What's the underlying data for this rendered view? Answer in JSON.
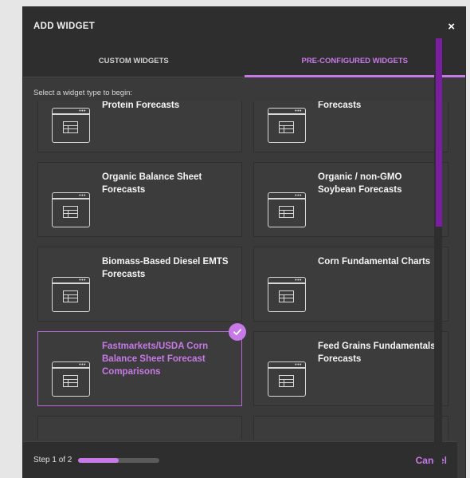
{
  "modal": {
    "title": "ADD WIDGET",
    "close_label": "×"
  },
  "tabs": [
    {
      "label": "CUSTOM WIDGETS",
      "active": false
    },
    {
      "label": "PRE-CONFIGURED WIDGETS",
      "active": true
    }
  ],
  "instruction": "Select a widget type to begin:",
  "widgets": [
    {
      "title": "Organic / non-GMO Animal Protein Forecasts",
      "selected": false,
      "icon": "table-window-icon"
    },
    {
      "title": "Organic / non-GMO Corn Forecasts",
      "selected": false,
      "icon": "table-window-icon"
    },
    {
      "title": "Organic Balance Sheet Forecasts",
      "selected": false,
      "icon": "table-window-icon"
    },
    {
      "title": "Organic / non-GMO Soybean Forecasts",
      "selected": false,
      "icon": "table-window-icon"
    },
    {
      "title": "Biomass-Based Diesel EMTS Forecasts",
      "selected": false,
      "icon": "table-window-icon"
    },
    {
      "title": "Corn Fundamental Charts",
      "selected": false,
      "icon": "table-window-icon"
    },
    {
      "title": "Fastmarkets/USDA Corn Balance Sheet Forecast Comparisons",
      "selected": true,
      "icon": "table-window-icon"
    },
    {
      "title": "Feed Grains Fundamentals Forecasts",
      "selected": false,
      "icon": "table-window-icon"
    },
    {
      "title": "",
      "selected": false,
      "icon": "table-window-icon"
    },
    {
      "title": "",
      "selected": false,
      "icon": "table-window-icon"
    }
  ],
  "footer": {
    "step_label": "Step 1 of 2",
    "progress": 0.5,
    "cancel_label": "Cancel"
  },
  "colors": {
    "accent": "#c879e8",
    "scroll_thumb": "#7a1ea0",
    "surface": "#3a3a3a",
    "header": "#2e2e2e"
  }
}
